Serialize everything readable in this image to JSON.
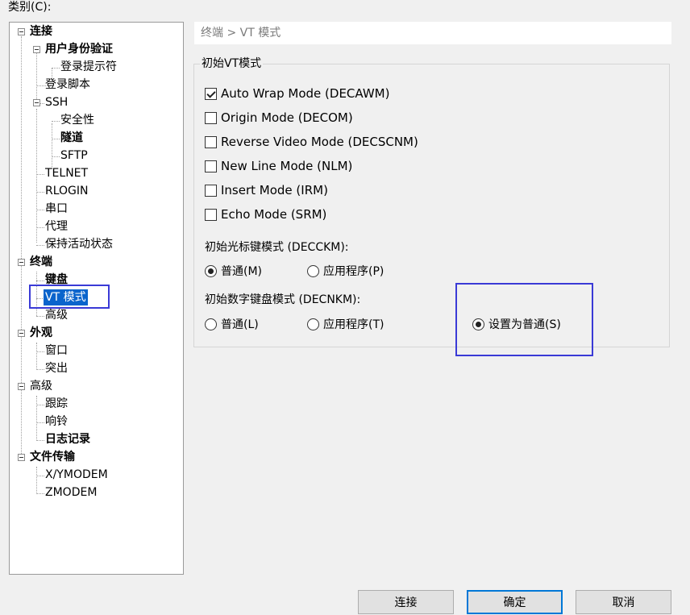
{
  "category_label": "类别(C):",
  "tree": {
    "items": [
      {
        "label": "连接"
      },
      {
        "label": "用户身份验证"
      },
      {
        "label": "登录提示符"
      },
      {
        "label": "登录脚本"
      },
      {
        "label": "SSH"
      },
      {
        "label": "安全性"
      },
      {
        "label": "隧道"
      },
      {
        "label": "SFTP"
      },
      {
        "label": "TELNET"
      },
      {
        "label": "RLOGIN"
      },
      {
        "label": "串口"
      },
      {
        "label": "代理"
      },
      {
        "label": "保持活动状态"
      },
      {
        "label": "终端"
      },
      {
        "label": "键盘"
      },
      {
        "label": "VT 模式"
      },
      {
        "label": "高级"
      },
      {
        "label": "外观"
      },
      {
        "label": "窗口"
      },
      {
        "label": "突出"
      },
      {
        "label": "高级"
      },
      {
        "label": "跟踪"
      },
      {
        "label": "响铃"
      },
      {
        "label": "日志记录"
      },
      {
        "label": "文件传输"
      },
      {
        "label": "X/YMODEM"
      },
      {
        "label": "ZMODEM"
      }
    ]
  },
  "breadcrumb": "终端 > VT 模式",
  "group_title": "初始VT模式",
  "modes": [
    {
      "label": "Auto Wrap Mode (DECAWM)",
      "checked": true
    },
    {
      "label": "Origin Mode (DECOM)",
      "checked": false
    },
    {
      "label": "Reverse Video Mode (DECSCNM)",
      "checked": false
    },
    {
      "label": "New Line Mode (NLM)",
      "checked": false
    },
    {
      "label": "Insert Mode (IRM)",
      "checked": false
    },
    {
      "label": "Echo Mode (SRM)",
      "checked": false
    }
  ],
  "cursor_keys": {
    "label": "初始光标键模式 (DECCKM):",
    "options": [
      {
        "label": "普通(M)",
        "checked": true
      },
      {
        "label": "应用程序(P)",
        "checked": false
      }
    ]
  },
  "keypad": {
    "label": "初始数字键盘模式 (DECNKM):",
    "options": [
      {
        "label": "普通(L)",
        "checked": false
      },
      {
        "label": "应用程序(T)",
        "checked": false
      },
      {
        "label": "设置为普通(S)",
        "checked": true
      }
    ]
  },
  "buttons": {
    "connect": "连接",
    "ok": "确定",
    "cancel": "取消"
  }
}
